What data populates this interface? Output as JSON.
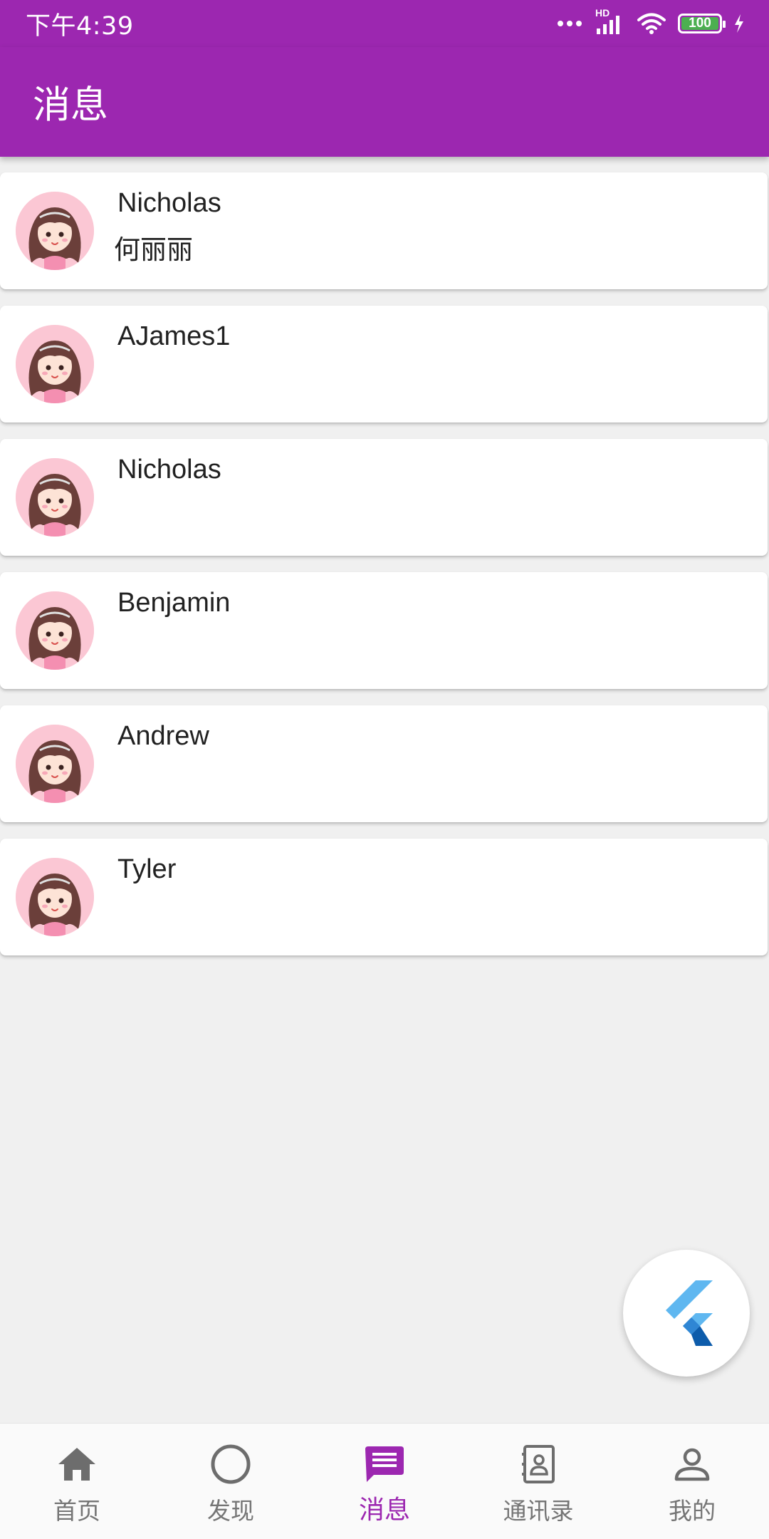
{
  "status_bar": {
    "time": "下午4:39",
    "network_label": "HD",
    "battery": "100",
    "battery_level": 1.0
  },
  "app_bar": {
    "title": "消息"
  },
  "messages": [
    {
      "name": "Nicholas",
      "preview": "何丽丽"
    },
    {
      "name": "AJames1",
      "preview": ""
    },
    {
      "name": "Nicholas",
      "preview": ""
    },
    {
      "name": "Benjamin",
      "preview": ""
    },
    {
      "name": "Andrew",
      "preview": ""
    },
    {
      "name": "Tyler",
      "preview": ""
    }
  ],
  "fab": {
    "icon": "flutter-logo-icon"
  },
  "bottom_nav": {
    "active_index": 2,
    "items": [
      {
        "label": "首页",
        "icon": "home-icon"
      },
      {
        "label": "发现",
        "icon": "circle-icon"
      },
      {
        "label": "消息",
        "icon": "message-icon"
      },
      {
        "label": "通讯录",
        "icon": "contacts-icon"
      },
      {
        "label": "我的",
        "icon": "person-icon"
      }
    ]
  },
  "colors": {
    "primary": "#9c27b0",
    "background": "#f0f0f0",
    "nav_inactive": "#757575",
    "avatar_bg": "#fbc7d4",
    "flutter_light": "#5fb7f0",
    "flutter_dark": "#0d5cab"
  }
}
